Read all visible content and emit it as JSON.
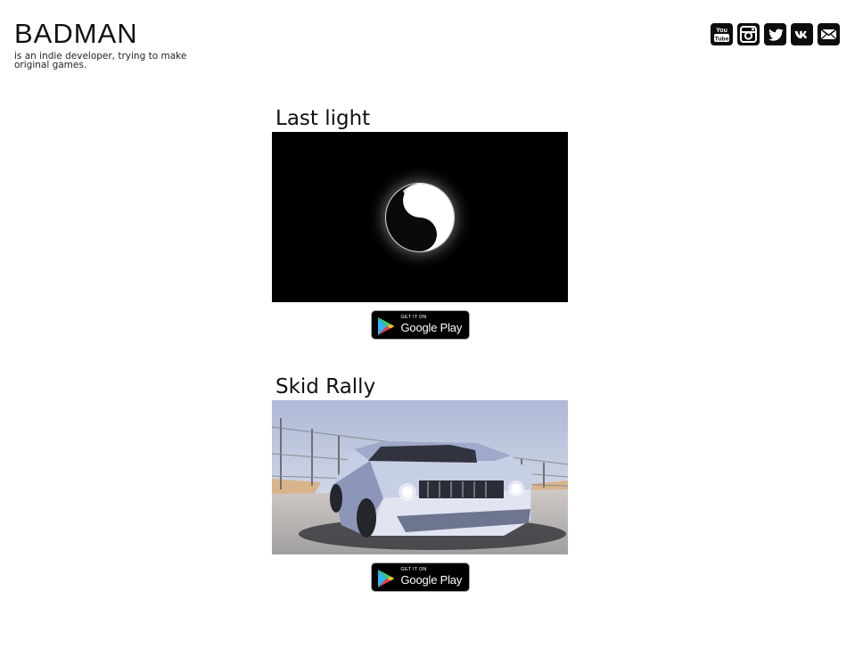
{
  "brand": {
    "title": "BADMAN",
    "tagline": "is an indie developer, trying to make original games."
  },
  "social": [
    {
      "icon": "youtube-icon",
      "label": "You Tube"
    },
    {
      "icon": "instagram-icon"
    },
    {
      "icon": "twitter-icon"
    },
    {
      "icon": "vk-icon",
      "label": "vk"
    },
    {
      "icon": "email-icon"
    }
  ],
  "games": [
    {
      "title": "Last light",
      "badge": {
        "small": "GET IT ON",
        "big": "Google Play"
      }
    },
    {
      "title": "Skid Rally",
      "badge": {
        "small": "GET IT ON",
        "big": "Google Play"
      }
    }
  ],
  "colors": {
    "text": "#111111",
    "badge_bg": "#000000",
    "social_bg": "#0d0d0d"
  }
}
